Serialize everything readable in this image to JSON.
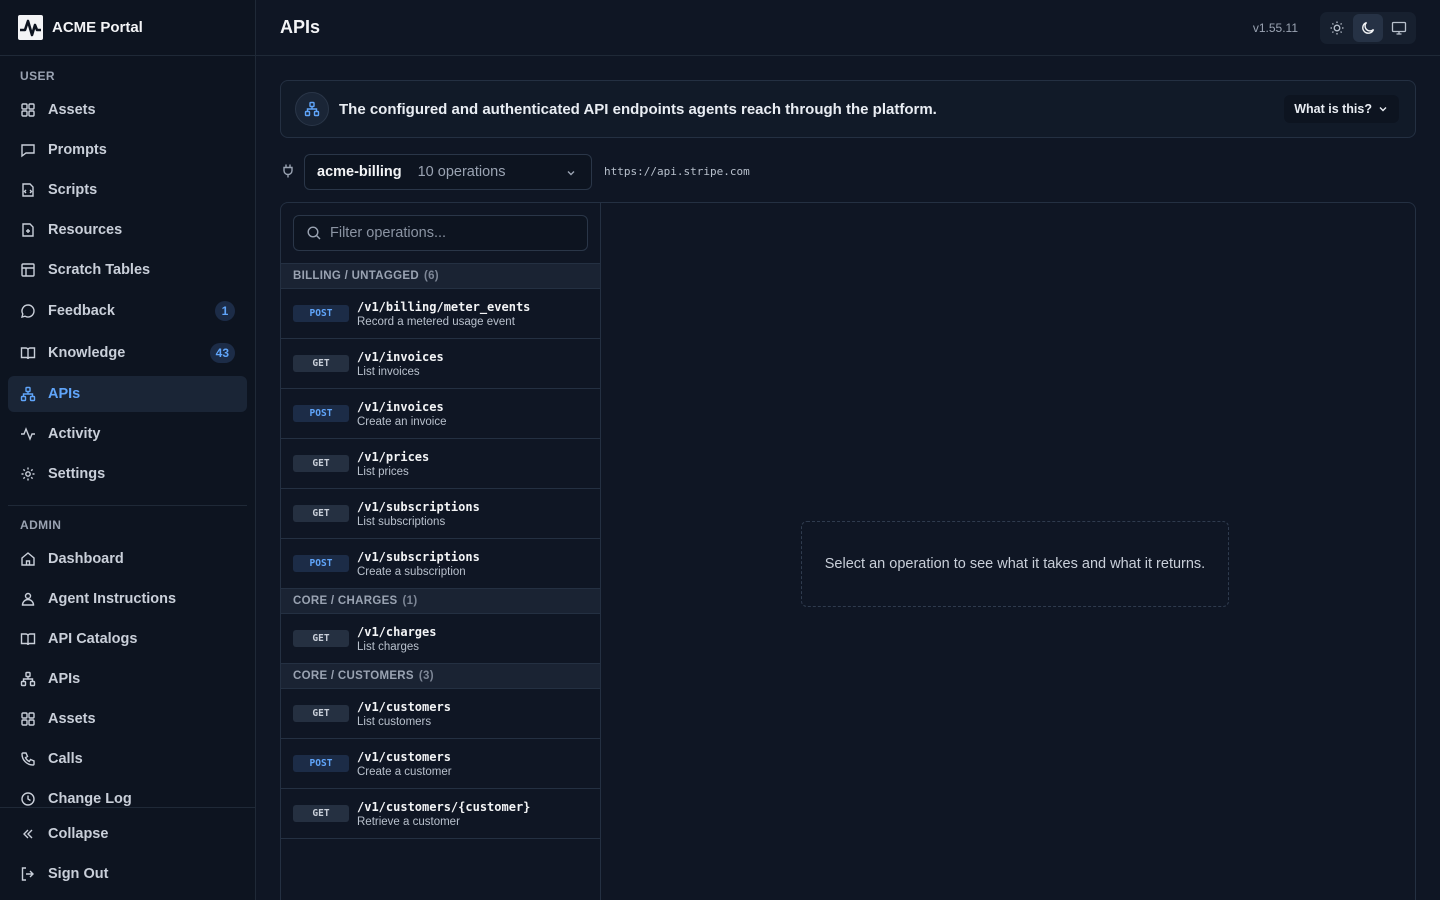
{
  "brand": {
    "name": "ACME Portal"
  },
  "sidebar": {
    "user_section": "USER",
    "user_items": [
      {
        "label": "Assets",
        "icon": "grid-icon"
      },
      {
        "label": "Prompts",
        "icon": "message-square-icon"
      },
      {
        "label": "Scripts",
        "icon": "code-icon"
      },
      {
        "label": "Resources",
        "icon": "file-plus-icon"
      },
      {
        "label": "Scratch Tables",
        "icon": "table-icon"
      },
      {
        "label": "Feedback",
        "icon": "message-circle-icon",
        "badge": "1"
      },
      {
        "label": "Knowledge",
        "icon": "book-open-icon",
        "badge": "43"
      },
      {
        "label": "APIs",
        "icon": "network-icon",
        "active": true
      },
      {
        "label": "Activity",
        "icon": "activity-icon"
      },
      {
        "label": "Settings",
        "icon": "gear-icon"
      }
    ],
    "admin_section": "ADMIN",
    "admin_items": [
      {
        "label": "Dashboard",
        "icon": "home-icon"
      },
      {
        "label": "Agent Instructions",
        "icon": "agent-icon"
      },
      {
        "label": "API Catalogs",
        "icon": "book-open-icon"
      },
      {
        "label": "APIs",
        "icon": "network-icon"
      },
      {
        "label": "Assets",
        "icon": "grid-icon"
      },
      {
        "label": "Calls",
        "icon": "phone-icon"
      },
      {
        "label": "Change Log",
        "icon": "clock-icon"
      }
    ],
    "collapse": "Collapse",
    "sign_out": "Sign Out"
  },
  "header": {
    "title": "APIs",
    "version": "v1.55.11",
    "theme_options": [
      "light",
      "dark",
      "system"
    ],
    "theme_selected": "dark"
  },
  "banner": {
    "text": "The configured and authenticated API endpoints agents reach through the platform.",
    "button": "What is this?"
  },
  "api_selector": {
    "name": "acme-billing",
    "operations": "10 operations",
    "base_url": "https://api.stripe.com"
  },
  "operations": {
    "filter_placeholder": "Filter operations...",
    "groups": [
      {
        "name": "BILLING / UNTAGGED",
        "count": "(6)",
        "items": [
          {
            "method": "POST",
            "path": "/v1/billing/meter_events",
            "desc": "Record a metered usage event"
          },
          {
            "method": "GET",
            "path": "/v1/invoices",
            "desc": "List invoices"
          },
          {
            "method": "POST",
            "path": "/v1/invoices",
            "desc": "Create an invoice"
          },
          {
            "method": "GET",
            "path": "/v1/prices",
            "desc": "List prices"
          },
          {
            "method": "GET",
            "path": "/v1/subscriptions",
            "desc": "List subscriptions"
          },
          {
            "method": "POST",
            "path": "/v1/subscriptions",
            "desc": "Create a subscription"
          }
        ]
      },
      {
        "name": "CORE / CHARGES",
        "count": "(1)",
        "items": [
          {
            "method": "GET",
            "path": "/v1/charges",
            "desc": "List charges"
          }
        ]
      },
      {
        "name": "CORE / CUSTOMERS",
        "count": "(3)",
        "items": [
          {
            "method": "GET",
            "path": "/v1/customers",
            "desc": "List customers"
          },
          {
            "method": "POST",
            "path": "/v1/customers",
            "desc": "Create a customer"
          },
          {
            "method": "GET",
            "path": "/v1/customers/{customer}",
            "desc": "Retrieve a customer"
          }
        ]
      }
    ]
  },
  "detail": {
    "empty_text": "Select an operation to see what it takes and what it returns."
  },
  "colors": {
    "accent": "#60a5fa",
    "background": "#0f1624",
    "sidebar": "#0d1420"
  }
}
